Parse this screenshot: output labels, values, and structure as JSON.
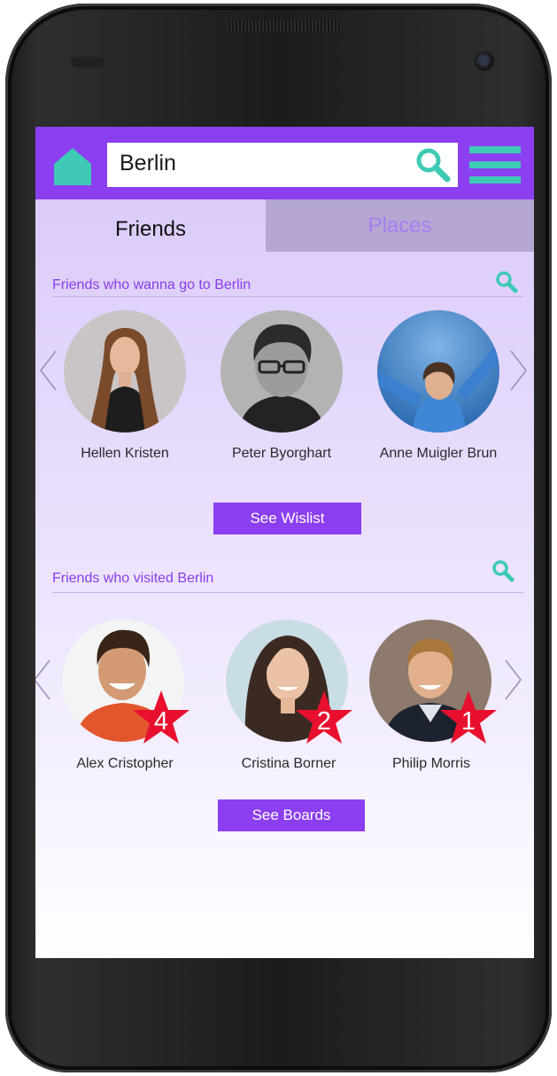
{
  "search": {
    "value": "Berlin"
  },
  "tabs": [
    {
      "label": "Friends",
      "active": true
    },
    {
      "label": "Places",
      "active": false
    }
  ],
  "wishlist_section": {
    "title": "Friends who wanna go to Berlin",
    "friends": [
      {
        "name": "Hellen Kristen"
      },
      {
        "name": "Peter Byorghart"
      },
      {
        "name": "Anne Muigler Brun"
      }
    ],
    "button_label": "See Wislist"
  },
  "visited_section": {
    "title": "Friends who visited Berlin",
    "friends": [
      {
        "name": "Alex Cristopher",
        "rank": "4"
      },
      {
        "name": "Cristina Borner",
        "rank": "2"
      },
      {
        "name": "Philip Morris",
        "rank": "1"
      }
    ],
    "button_label": "See Boards"
  },
  "icons": {
    "home": "home-icon",
    "search": "search-icon",
    "menu": "hamburger-menu-icon",
    "prev": "chevron-left-icon",
    "next": "chevron-right-icon",
    "rank_badge": "star-badge-icon"
  },
  "colors": {
    "brand_purple": "#8b3ff0",
    "accent_teal": "#3ecab5",
    "badge_red": "#e8102e",
    "inactive_tab": "#b6a6d4"
  }
}
